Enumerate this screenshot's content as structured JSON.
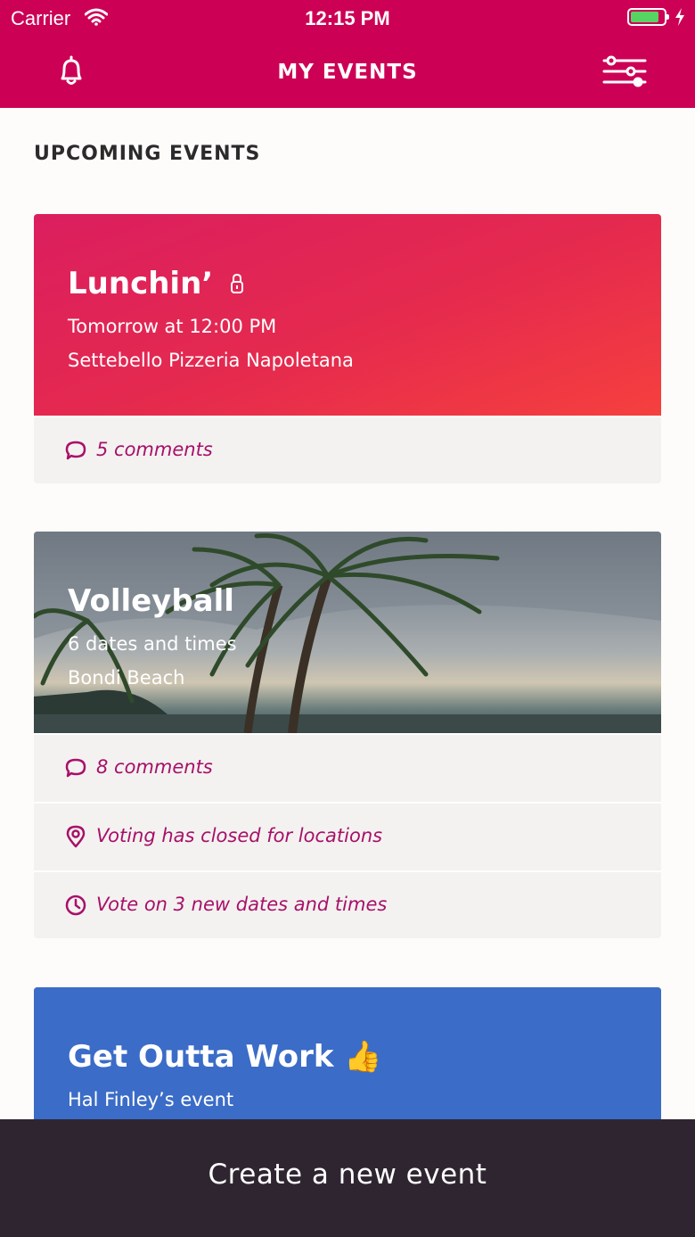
{
  "status_bar": {
    "carrier": "Carrier",
    "time": "12:15 PM",
    "battery_level": 0.85
  },
  "nav": {
    "title": "MY EVENTS",
    "left_icon": "bell-icon",
    "right_icon": "filter-sliders-icon"
  },
  "section": {
    "title": "UPCOMING EVENTS"
  },
  "events": [
    {
      "title": "Lunchin’",
      "title_icon": "lock-icon",
      "line1": "Tomorrow at 12:00 PM",
      "line2": "Settebello Pizzeria Napoletana",
      "rows": [
        {
          "icon": "comment-icon",
          "label": "5 comments"
        }
      ]
    },
    {
      "title": "Volleyball",
      "line1": "6 dates and times",
      "line2": "Bondi Beach",
      "background": "palm-trees-beach-photo",
      "rows": [
        {
          "icon": "comment-icon",
          "label": "8 comments"
        },
        {
          "icon": "location-pin-icon",
          "label": "Voting has closed for locations"
        },
        {
          "icon": "clock-icon",
          "label": "Vote on 3 new dates and times"
        }
      ]
    },
    {
      "title": "Get Outta Work",
      "title_emoji": "👍",
      "line1": "Hal Finley’s event"
    }
  ],
  "footer": {
    "create_label": "Create a new event"
  },
  "colors": {
    "brand": "#cc0055",
    "accent_text": "#a8106a",
    "lunch_gradient_start": "#db1e5f",
    "lunch_gradient_end": "#f5403e",
    "work_card": "#3b6cc7",
    "footer_bar": "#2f2531"
  }
}
